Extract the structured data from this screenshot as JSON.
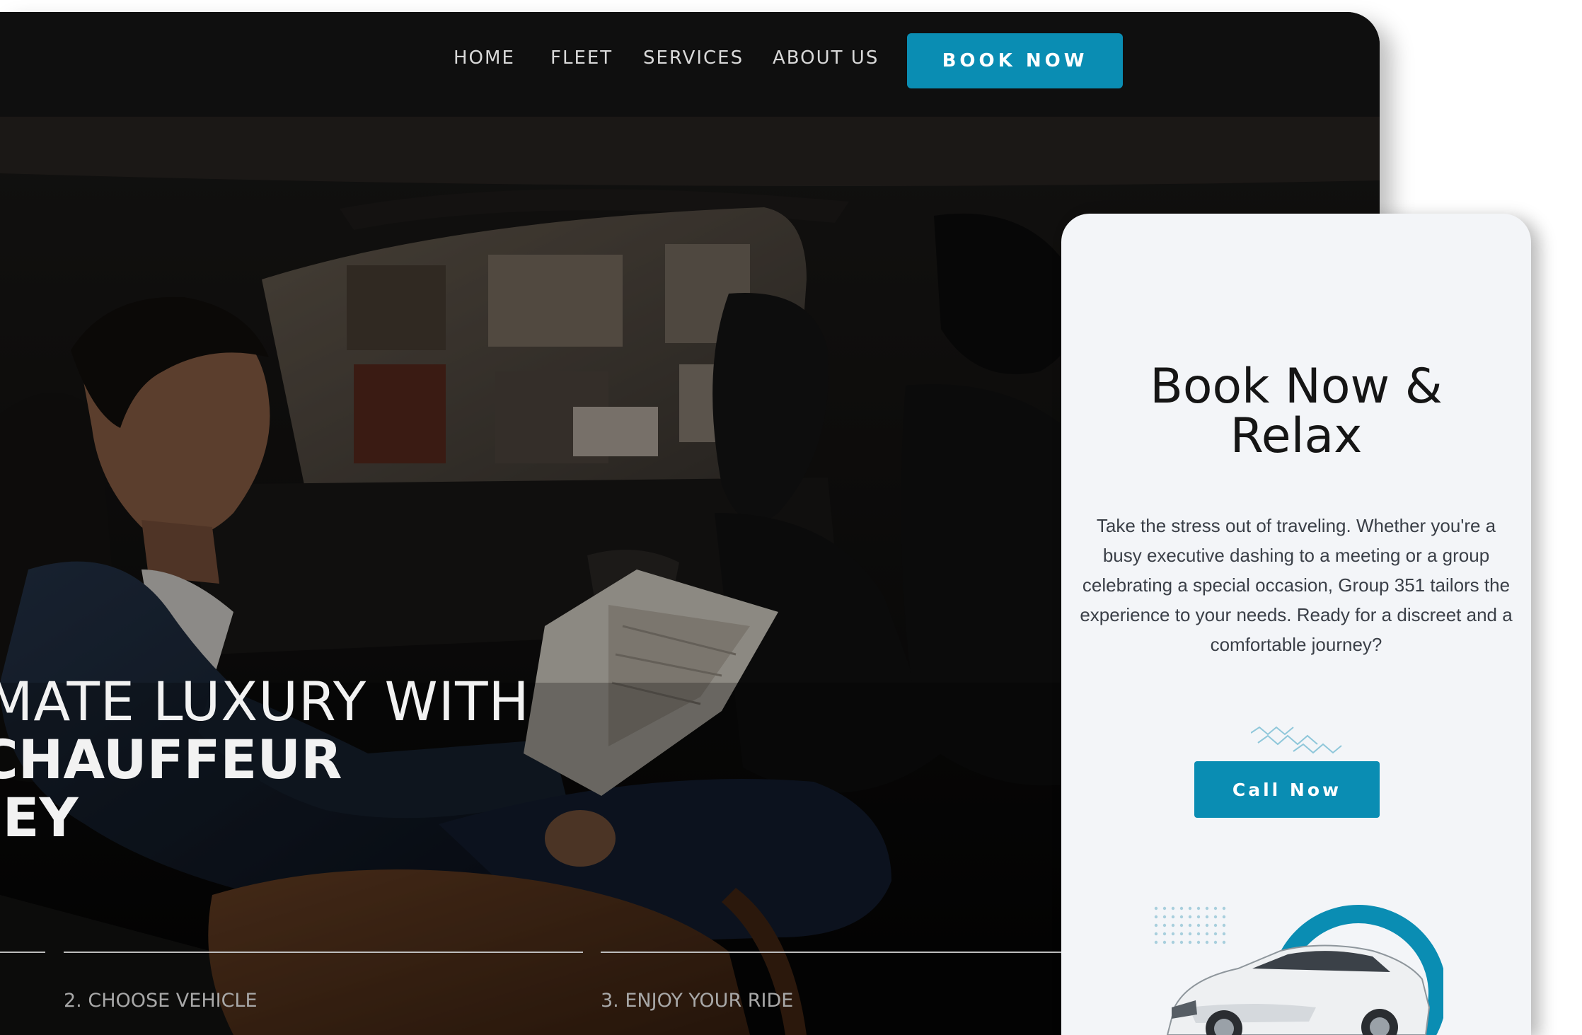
{
  "nav": {
    "links": [
      "HOME",
      "FLEET",
      "SERVICES",
      "ABOUT US"
    ],
    "book_label": "BOOK NOW"
  },
  "hero": {
    "line1": "TIMATE LUXURY WITH",
    "line2": "CHAUFFEUR",
    "line3": "NEY",
    "steps": [
      "2. CHOOSE VEHICLE",
      "3. ENJOY YOUR RIDE"
    ]
  },
  "mobile": {
    "title_line1": "Book Now &",
    "title_line2": "Relax",
    "text": "Take the stress out of traveling. Whether you're a busy executive dashing to a meeting or a group celebrating a special occasion, Group 351 tailors the experience to your needs. Ready for a discreet and a comfortable journey?",
    "call_label": "Call Now"
  },
  "colors": {
    "accent": "#0a8db3",
    "nav_bg": "#0f0f0f",
    "card_bg": "#f3f5f8"
  },
  "icons": [
    "squiggle-decoration-icon",
    "dot-grid-decoration-icon",
    "car-image"
  ]
}
